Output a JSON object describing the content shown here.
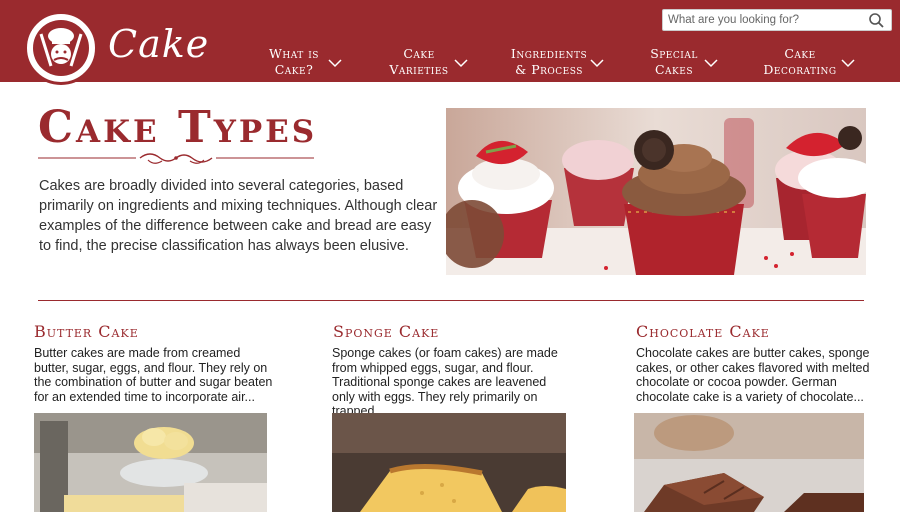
{
  "brand": {
    "name": "Cake"
  },
  "search": {
    "placeholder": "What are you looking for?"
  },
  "nav": [
    {
      "line1": "What is",
      "line2": "Cake?"
    },
    {
      "line1": "Cake",
      "line2": "Varieties"
    },
    {
      "line1": "Ingredients",
      "line2": "& Process"
    },
    {
      "line1": "Special",
      "line2": "Cakes"
    },
    {
      "line1": "Cake",
      "line2": "Decorating"
    }
  ],
  "intro": {
    "title": "Cake Types",
    "text": "Cakes are broadly divided into several categories, based primarily on ingredients and mixing techniques. Although clear examples of the difference between cake and bread are easy to find, the precise classification has always been elusive."
  },
  "cards": [
    {
      "title": "Butter Cake",
      "desc": "Butter cakes are made from creamed butter, sugar, eggs, and flour. They rely on the combination of butter and sugar beaten for an extended time to incorporate air..."
    },
    {
      "title": "Sponge Cake",
      "desc": "Sponge cakes (or foam cakes) are made from whipped eggs, sugar, and flour. Traditional sponge cakes are leavened only with eggs. They rely primarily on trapped..."
    },
    {
      "title": "Chocolate Cake",
      "desc": "Chocolate cakes are butter cakes, sponge cakes, or other cakes flavored with melted chocolate or cocoa powder. German chocolate cake is a variety of chocolate..."
    }
  ],
  "colors": {
    "brand": "#9a2a2e",
    "text": "#333333"
  }
}
